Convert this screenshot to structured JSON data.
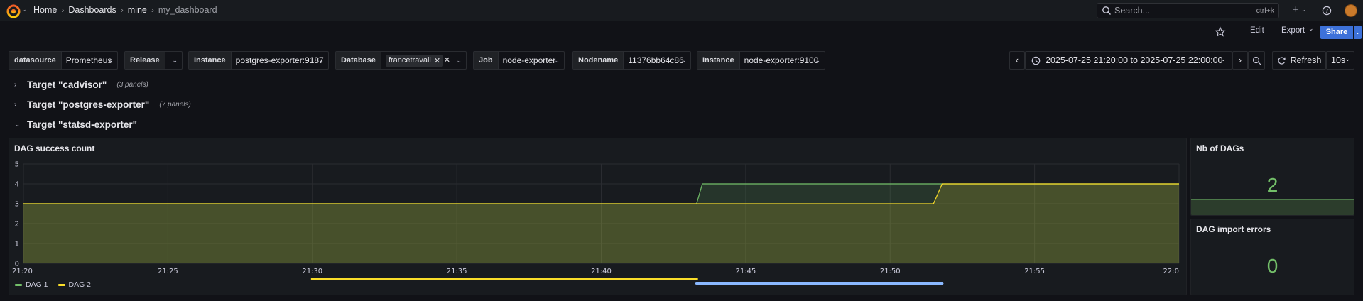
{
  "nav": {
    "breadcrumbs": [
      "Home",
      "Dashboards",
      "mine",
      "my_dashboard"
    ],
    "search_placeholder": "Search...",
    "search_shortcut": "ctrl+k",
    "plus_label": "+"
  },
  "actions": {
    "edit_label": "Edit",
    "export_label": "Export",
    "share_label": "Share"
  },
  "variables": [
    {
      "label": "datasource",
      "value": "Prometheus"
    },
    {
      "label": "Release",
      "value": ""
    },
    {
      "label": "Instance",
      "value": "postgres-exporter:9187"
    },
    {
      "label": "Database",
      "value": "francetravail"
    },
    {
      "label": "Job",
      "value": "node-exporter"
    },
    {
      "label": "Nodename",
      "value": "11376bb64c86"
    },
    {
      "label": "Instance",
      "value": "node-exporter:9100"
    }
  ],
  "time": {
    "range": "2025-07-25 21:20:00 to 2025-07-25 22:00:00",
    "refresh_label": "Refresh",
    "refresh_interval": "10s"
  },
  "rows": [
    {
      "title": "Target \"cadvisor\"",
      "count": "(3 panels)",
      "collapsed": true
    },
    {
      "title": "Target \"postgres-exporter\"",
      "count": "(7 panels)",
      "collapsed": true
    },
    {
      "title": "Target \"statsd-exporter\"",
      "count": "",
      "collapsed": false
    }
  ],
  "panels": {
    "dag_success": {
      "title": "DAG success count"
    },
    "nb_dags": {
      "title": "Nb of DAGs",
      "value": "2"
    },
    "import_errors": {
      "title": "DAG import errors",
      "value": "0"
    }
  },
  "colors": {
    "dag1": "#73bf69",
    "dag2": "#fade2a",
    "annotation_yellow": "#fade2a",
    "annotation_blue": "#8ab8ff",
    "stat": "#73bf69"
  },
  "chart_data": {
    "type": "line",
    "title": "DAG success count",
    "x": [
      "21:20",
      "21:25",
      "21:30",
      "21:35",
      "21:40",
      "21:45",
      "21:50",
      "21:55",
      "22:0"
    ],
    "ylim": [
      0,
      5
    ],
    "yticks": [
      "0",
      "1",
      "2",
      "3",
      "4",
      "5"
    ],
    "series": [
      {
        "name": "DAG 1",
        "points": [
          [
            0,
            3
          ],
          [
            23.3,
            3
          ],
          [
            23.5,
            4
          ],
          [
            40,
            4
          ]
        ]
      },
      {
        "name": "DAG 2",
        "points": [
          [
            0,
            3
          ],
          [
            31.5,
            3
          ],
          [
            31.8,
            4
          ],
          [
            40,
            4
          ]
        ]
      }
    ],
    "annotations": [
      {
        "color": "yellow",
        "start": 10,
        "end": 23.3
      },
      {
        "color": "blue",
        "start": 23.3,
        "end": 31.8
      }
    ],
    "legend_position": "bottom-left",
    "grid": true
  }
}
